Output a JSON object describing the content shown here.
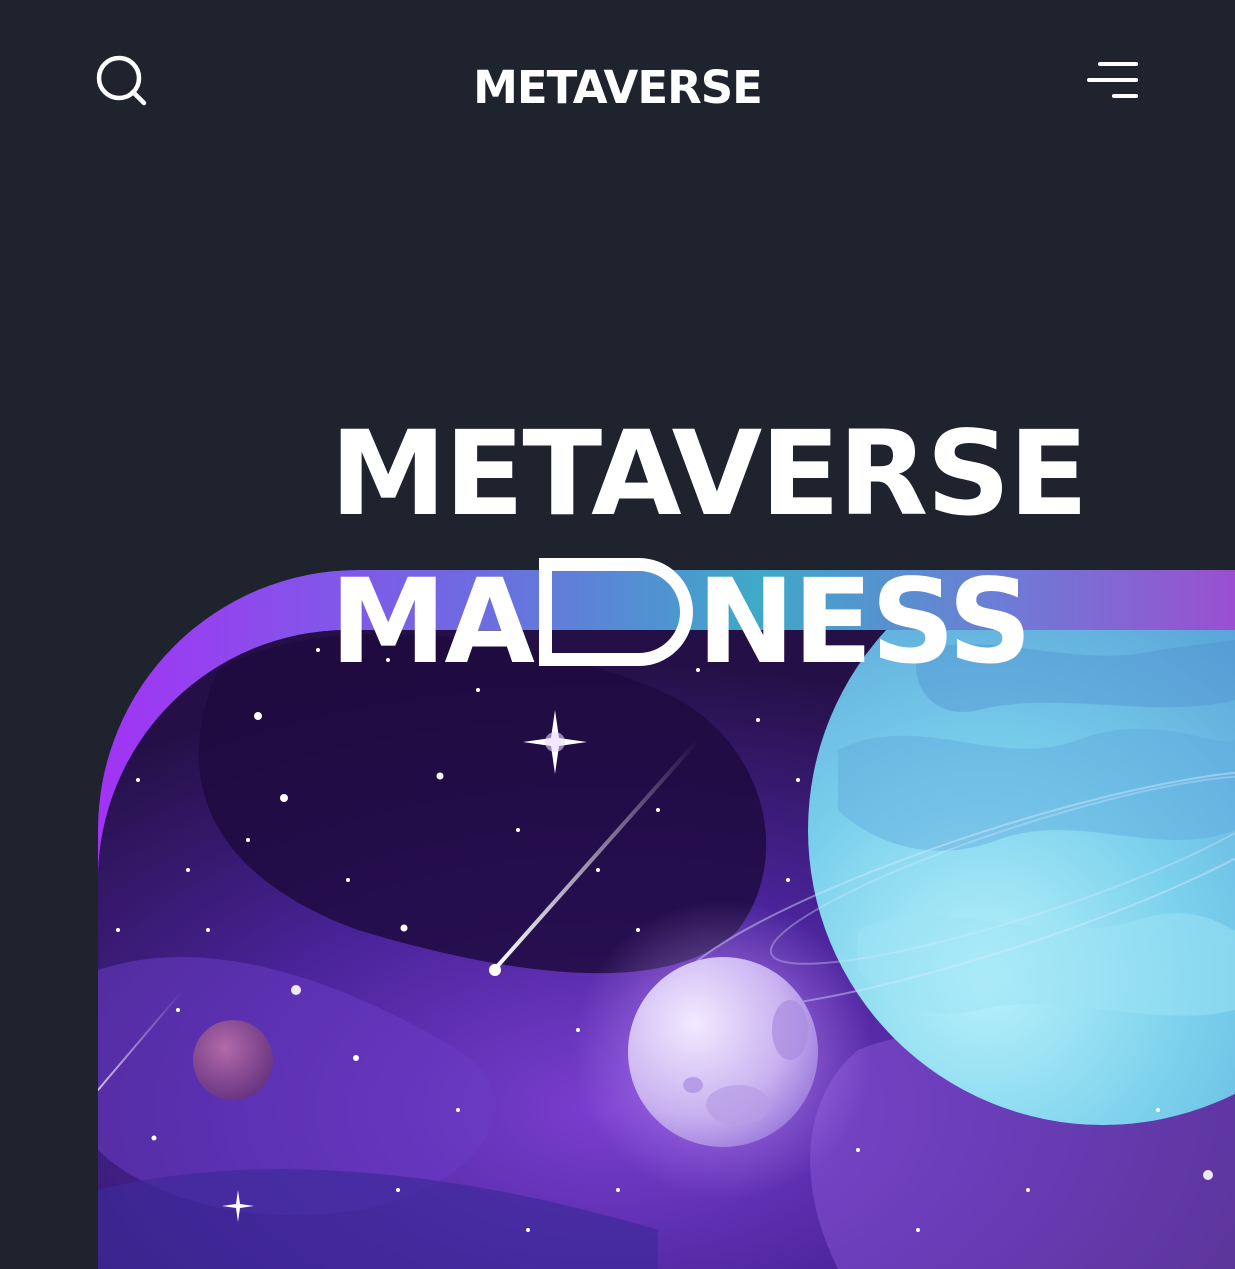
{
  "header": {
    "brand": "METAVERSE",
    "search_icon": "search-icon",
    "menu_icon": "menu-icon"
  },
  "hero": {
    "title_line1": "METAVERSE",
    "title_line2_start": "MA",
    "title_line2_end": "NESS"
  },
  "colors": {
    "background": "#1e232d",
    "text": "#ffffff",
    "gradient_start": "#a233f5",
    "gradient_mid": "#3fa9c7",
    "gradient_end": "#9a4fd0",
    "planet_cyan": "#7fd3ee",
    "space_purple": "#3b1f7a"
  }
}
